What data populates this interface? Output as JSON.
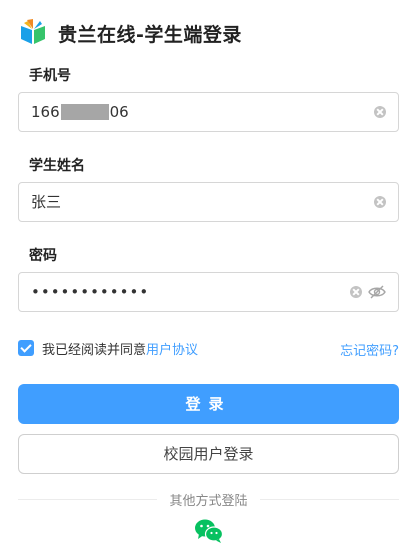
{
  "header": {
    "title": "贵兰在线-学生端登录"
  },
  "phone": {
    "label": "手机号",
    "value_prefix": "166",
    "value_suffix": "06"
  },
  "name": {
    "label": "学生姓名",
    "value": "张三"
  },
  "password": {
    "label": "密码",
    "value": "••••••••••••"
  },
  "agreement": {
    "checked": true,
    "text": "我已经阅读并同意",
    "link": "用户协议"
  },
  "forgot": "忘记密码?",
  "buttons": {
    "login": "登录",
    "campus_login": "校园用户登录"
  },
  "other_login": {
    "label": "其他方式登陆",
    "icons": [
      "wechat-icon"
    ]
  },
  "colors": {
    "accent": "#409eff",
    "wechat": "#07c160"
  }
}
